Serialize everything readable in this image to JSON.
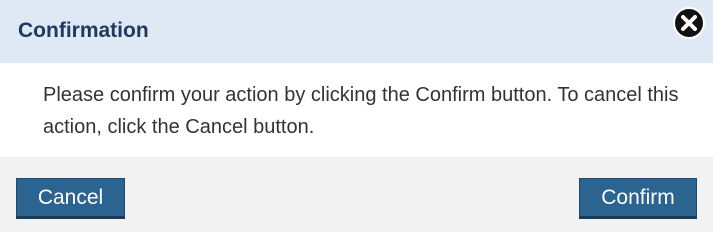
{
  "dialog": {
    "title": "Confirmation",
    "close_icon": "close-icon",
    "message": "Please confirm your action by clicking the Confirm button. To cancel this action, click the Cancel button.",
    "buttons": {
      "cancel_label": "Cancel",
      "confirm_label": "Confirm"
    }
  },
  "colors": {
    "header_bg": "#dfe8f5",
    "title_text": "#1f3a5f",
    "footer_bg": "#f2f2f2",
    "button_bg": "#2b6391"
  }
}
